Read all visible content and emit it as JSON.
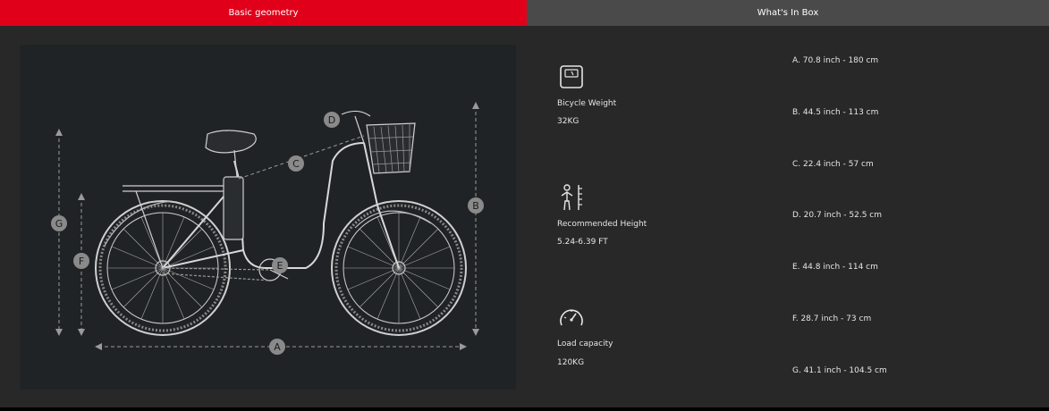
{
  "tabs": [
    {
      "label": "Basic geometry",
      "active": true
    },
    {
      "label": "What's In  Box",
      "active": false
    }
  ],
  "colors": {
    "accent": "#e1001a",
    "tab_inactive": "#4a4a4a",
    "panel": "#202325",
    "background": "#282828"
  },
  "bike": {
    "markers": {
      "a": "A",
      "b": "B",
      "c": "C",
      "d": "D",
      "e": "E",
      "f": "F",
      "g": "G"
    }
  },
  "specs": [
    {
      "icon": "scale-icon",
      "label": "Bicycle Weight",
      "value": "32KG"
    },
    {
      "icon": "person-height-icon",
      "label": "Recommended  Height",
      "value": "5.24-6.39 FT"
    },
    {
      "icon": "gauge-icon",
      "label": "Load capacity",
      "value": "120KG"
    }
  ],
  "dimensions": [
    "A. 70.8 inch - 180 cm",
    "B. 44.5 inch - 113 cm",
    "C. 22.4 inch - 57 cm",
    "D. 20.7 inch - 52.5 cm",
    "E. 44.8 inch - 114 cm",
    "F. 28.7 inch - 73 cm",
    "G. 41.1 inch - 104.5 cm"
  ]
}
